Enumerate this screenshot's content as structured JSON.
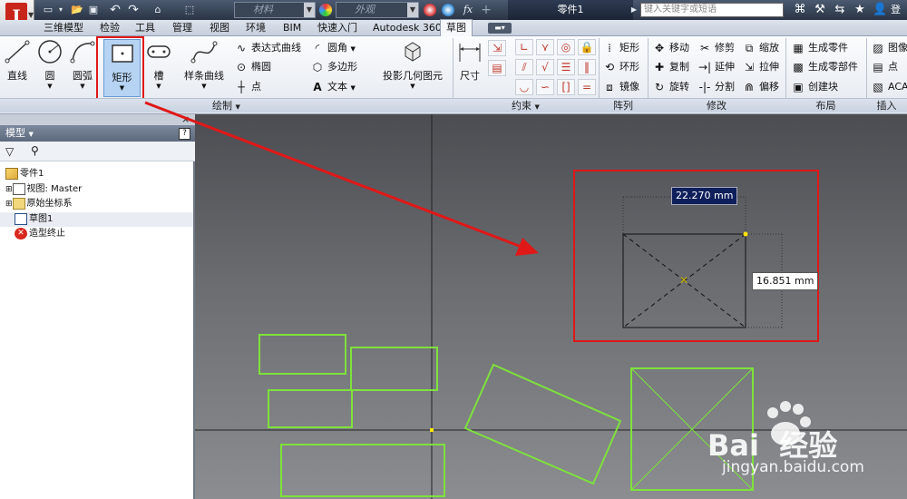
{
  "app": {
    "logo_letter": "I"
  },
  "quickaccess": {
    "material": {
      "placeholder": "材料"
    },
    "appearance": {
      "placeholder": "外观"
    },
    "fx_label": "fx"
  },
  "document_title": "零件1",
  "search": {
    "placeholder": "键入关键字或短语"
  },
  "user_label": "登",
  "tabs": [
    {
      "label": "三维模型"
    },
    {
      "label": "检验"
    },
    {
      "label": "工具"
    },
    {
      "label": "管理"
    },
    {
      "label": "视图"
    },
    {
      "label": "环境"
    },
    {
      "label": "BIM"
    },
    {
      "label": "快速入门"
    },
    {
      "label": "Autodesk 360"
    },
    {
      "label": "草图"
    }
  ],
  "ribbon": {
    "draw": {
      "line": "直线",
      "circle": "圆",
      "arc": "圆弧",
      "rectangle": "矩形",
      "slot": "槽",
      "spline": "样条曲线",
      "equation_curve": "表达式曲线",
      "ellipse": "椭圆",
      "point": "点",
      "fillet": "圆角",
      "polygon": "多边形",
      "text": "文本",
      "project_geometry": "投影几何图元",
      "panel_title": "绘制"
    },
    "constrain": {
      "dimension": "尺寸",
      "panel_title": "约束"
    },
    "pattern": {
      "rectangular": "矩形",
      "circular": "环形",
      "mirror": "镜像",
      "panel_title": "阵列"
    },
    "modify": {
      "move": "移动",
      "trim": "修剪",
      "scale": "缩放",
      "copy": "复制",
      "extend": "延伸",
      "stretch": "拉伸",
      "rotate": "旋转",
      "split": "分割",
      "offset": "偏移",
      "panel_title": "修改"
    },
    "layout": {
      "make_part": "生成零件",
      "make_components": "生成零部件",
      "create_block": "创建块",
      "panel_title": "布局"
    },
    "insert": {
      "image": "图像",
      "points": "点",
      "acad": "ACA",
      "panel_title": "插入"
    }
  },
  "browser": {
    "header": "模型",
    "tree": [
      {
        "label": "零件1"
      },
      {
        "label": "视图: Master"
      },
      {
        "label": "原始坐标系"
      },
      {
        "label": "草图1"
      },
      {
        "label": "造型终止"
      }
    ],
    "close_glyph": "×",
    "help_glyph": "?"
  },
  "canvas": {
    "dim_width": "22.270 mm",
    "dim_height": "16.851 mm",
    "watermark_brand": "Bai  经验",
    "watermark_url": "jingyan.baidu.com"
  },
  "colors": {
    "sketch_green": "#7ee23b",
    "highlight_red": "#e01818",
    "ribbon_active": "#b6d3f3",
    "title_bar": "#2a3445"
  }
}
